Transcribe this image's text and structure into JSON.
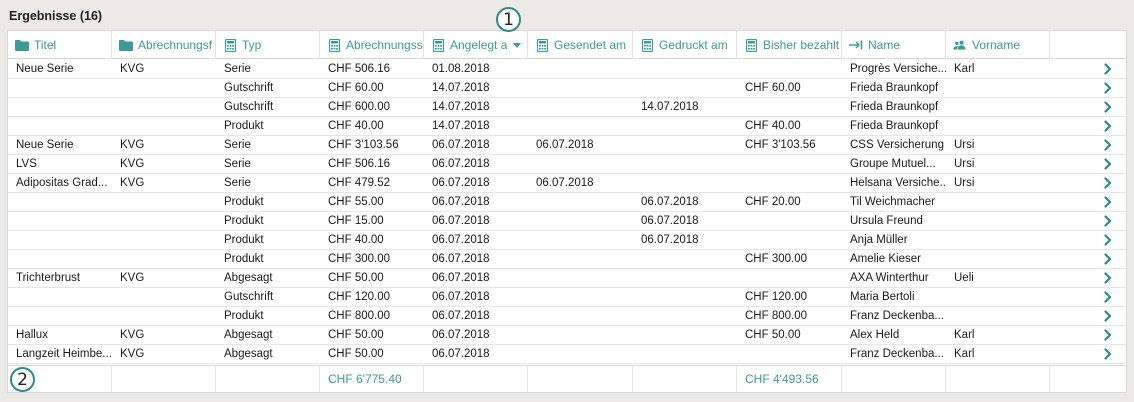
{
  "panel": {
    "title": "Ergebnisse (16)"
  },
  "colors": {
    "accent": "#3d9a96",
    "badge_ring": "#2e8a86"
  },
  "columns": [
    {
      "label": "Titel",
      "icon": "folder-icon"
    },
    {
      "label": "Abrechnungsf",
      "icon": "folder-icon"
    },
    {
      "label": "Typ",
      "icon": "calculator-icon"
    },
    {
      "label": "Abrechnungssu",
      "icon": "calculator-icon"
    },
    {
      "label": "Angelegt a",
      "icon": "calculator-icon",
      "sorted": "descending"
    },
    {
      "label": "Gesendet am",
      "icon": "calculator-icon"
    },
    {
      "label": "Gedruckt am",
      "icon": "calculator-icon"
    },
    {
      "label": "Bisher bezahlt",
      "icon": "calculator-icon"
    },
    {
      "label": "Name",
      "icon": "arrow-to-line-icon"
    },
    {
      "label": "Vorname",
      "icon": "users-icon"
    }
  ],
  "rows": [
    [
      "Neue Serie",
      "KVG",
      "Serie",
      "CHF 506.16",
      "01.08.2018",
      "",
      "",
      "",
      "Progrès Versiche...",
      "Karl"
    ],
    [
      "",
      "",
      "Gutschrift",
      "CHF 60.00",
      "14.07.2018",
      "",
      "",
      "CHF 60.00",
      "Frieda Braunkopf",
      ""
    ],
    [
      "",
      "",
      "Gutschrift",
      "CHF 600.00",
      "14.07.2018",
      "",
      "14.07.2018",
      "",
      "Frieda Braunkopf",
      ""
    ],
    [
      "",
      "",
      "Produkt",
      "CHF 40.00",
      "14.07.2018",
      "",
      "",
      "CHF 40.00",
      "Frieda Braunkopf",
      ""
    ],
    [
      "Neue Serie",
      "KVG",
      "Serie",
      "CHF 3'103.56",
      "06.07.2018",
      "06.07.2018",
      "",
      "CHF 3'103.56",
      "CSS Versicherung",
      "Ursi"
    ],
    [
      "LVS",
      "KVG",
      "Serie",
      "CHF 506.16",
      "06.07.2018",
      "",
      "",
      "",
      "Groupe Mutuel...",
      "Ursi"
    ],
    [
      "Adipositas Grad...",
      "KVG",
      "Serie",
      "CHF 479.52",
      "06.07.2018",
      "06.07.2018",
      "",
      "",
      "Helsana Versiche...",
      "Ursi"
    ],
    [
      "",
      "",
      "Produkt",
      "CHF 55.00",
      "06.07.2018",
      "",
      "06.07.2018",
      "CHF 20.00",
      "Til Weichmacher",
      ""
    ],
    [
      "",
      "",
      "Produkt",
      "CHF 15.00",
      "06.07.2018",
      "",
      "06.07.2018",
      "",
      "Ursula Freund",
      ""
    ],
    [
      "",
      "",
      "Produkt",
      "CHF 40.00",
      "06.07.2018",
      "",
      "06.07.2018",
      "",
      "Anja Müller",
      ""
    ],
    [
      "",
      "",
      "Produkt",
      "CHF 300.00",
      "06.07.2018",
      "",
      "",
      "CHF 300.00",
      "Amelie Kieser",
      ""
    ],
    [
      "Trichterbrust",
      "KVG",
      "Abgesagt",
      "CHF 50.00",
      "06.07.2018",
      "",
      "",
      "",
      "AXA Winterthur",
      "Ueli"
    ],
    [
      "",
      "",
      "Gutschrift",
      "CHF 120.00",
      "06.07.2018",
      "",
      "",
      "CHF 120.00",
      "Maria Bertoli",
      ""
    ],
    [
      "",
      "",
      "Produkt",
      "CHF 800.00",
      "06.07.2018",
      "",
      "",
      "CHF 800.00",
      "Franz Deckenba...",
      ""
    ],
    [
      "Hallux",
      "KVG",
      "Abgesagt",
      "CHF 50.00",
      "06.07.2018",
      "",
      "",
      "CHF 50.00",
      "Alex Held",
      "Karl"
    ],
    [
      "Langzeit Heimbe...",
      "KVG",
      "Abgesagt",
      "CHF 50.00",
      "06.07.2018",
      "",
      "",
      "",
      "Franz Deckenba...",
      "Karl"
    ]
  ],
  "footer": {
    "sum_amount": "CHF 6'775.40",
    "sum_paid": "CHF 4'493.56"
  },
  "badges": {
    "one": "1",
    "two": "2"
  }
}
